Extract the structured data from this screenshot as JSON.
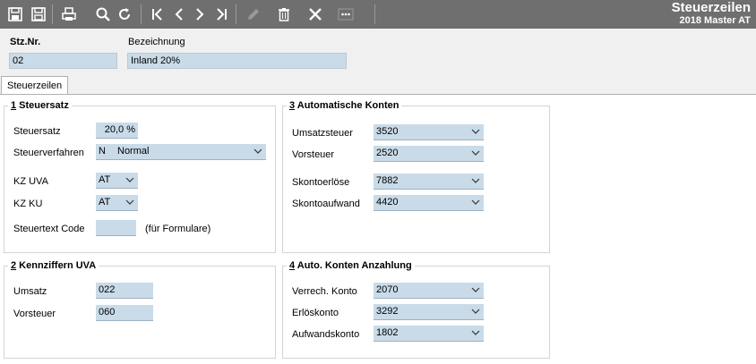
{
  "toolbar": {
    "buttons": [
      {
        "name": "save-icon"
      },
      {
        "name": "save-close-icon"
      },
      {
        "name": "print-icon"
      },
      {
        "name": "search-icon"
      },
      {
        "name": "refresh-icon"
      },
      {
        "name": "first-record-icon"
      },
      {
        "name": "previous-record-icon"
      },
      {
        "name": "next-record-icon"
      },
      {
        "name": "last-record-icon"
      },
      {
        "name": "edit-icon"
      },
      {
        "name": "delete-icon"
      },
      {
        "name": "close-icon"
      },
      {
        "name": "more-icon"
      }
    ]
  },
  "app": {
    "title": "Steuerzeilen",
    "subtitle": "2018 Master AT"
  },
  "header": {
    "stz_label": "Stz.Nr.",
    "stz_value": "02",
    "bez_label": "Bezeichnung",
    "bez_value": "Inland 20%"
  },
  "tabs": [
    {
      "label": "Steuerzeilen"
    }
  ],
  "groups": {
    "steuersatz": {
      "num": "1",
      "title": " Steuersatz",
      "steuersatz_label": "Steuersatz",
      "steuersatz_value": "20,0 %",
      "verfahren_label": "Steuerverfahren",
      "verfahren_code": "N",
      "verfahren_value": "Normal",
      "kzuva_label": "KZ UVA",
      "kzuva_value": "AT",
      "kzku_label": "KZ KU",
      "kzku_value": "AT",
      "steuertext_label": "Steuertext Code",
      "steuertext_value": "",
      "steuertext_hint": "(für Formulare)"
    },
    "kennziffern": {
      "num": "2",
      "title": " Kennziffern UVA",
      "umsatz_label": "Umsatz",
      "umsatz_value": "022",
      "vorsteuer_label": "Vorsteuer",
      "vorsteuer_value": "060"
    },
    "autokonten": {
      "num": "3",
      "title": " Automatische Konten",
      "umsatzsteuer_label": "Umsatzsteuer",
      "umsatzsteuer_value": "3520",
      "vorsteuer_label": "Vorsteuer",
      "vorsteuer_value": "2520",
      "skontoerloese_label": "Skontoerlöse",
      "skontoerloese_value": "7882",
      "skontoaufwand_label": "Skontoaufwand",
      "skontoaufwand_value": "4420"
    },
    "anzahlung": {
      "num": "4",
      "title": " Auto. Konten Anzahlung",
      "verrech_label": "Verrech. Konto",
      "verrech_value": "2070",
      "erloes_label": "Erlöskonto",
      "erloes_value": "3292",
      "aufwand_label": "Aufwandskonto",
      "aufwand_value": "1802"
    }
  }
}
